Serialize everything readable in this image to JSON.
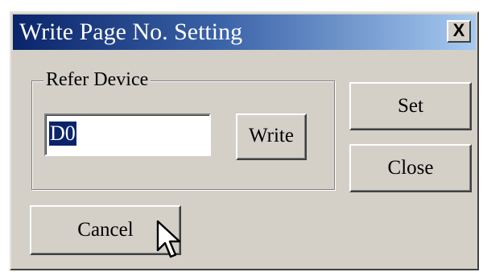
{
  "dialog": {
    "title": "Write Page No. Setting",
    "close_glyph": "X"
  },
  "group": {
    "label": "Refer Device",
    "input_value": "D0",
    "write_label": "Write"
  },
  "buttons": {
    "set_label": "Set",
    "close_label": "Close",
    "cancel_label": "Cancel"
  },
  "icons": {
    "close": "close-icon",
    "cursor": "mouse-pointer-icon"
  },
  "colors": {
    "titlebar_start": "#0a246a",
    "titlebar_end": "#a6caf0",
    "dialog_bg": "#d4d0c8",
    "selection": "#0a246a"
  }
}
